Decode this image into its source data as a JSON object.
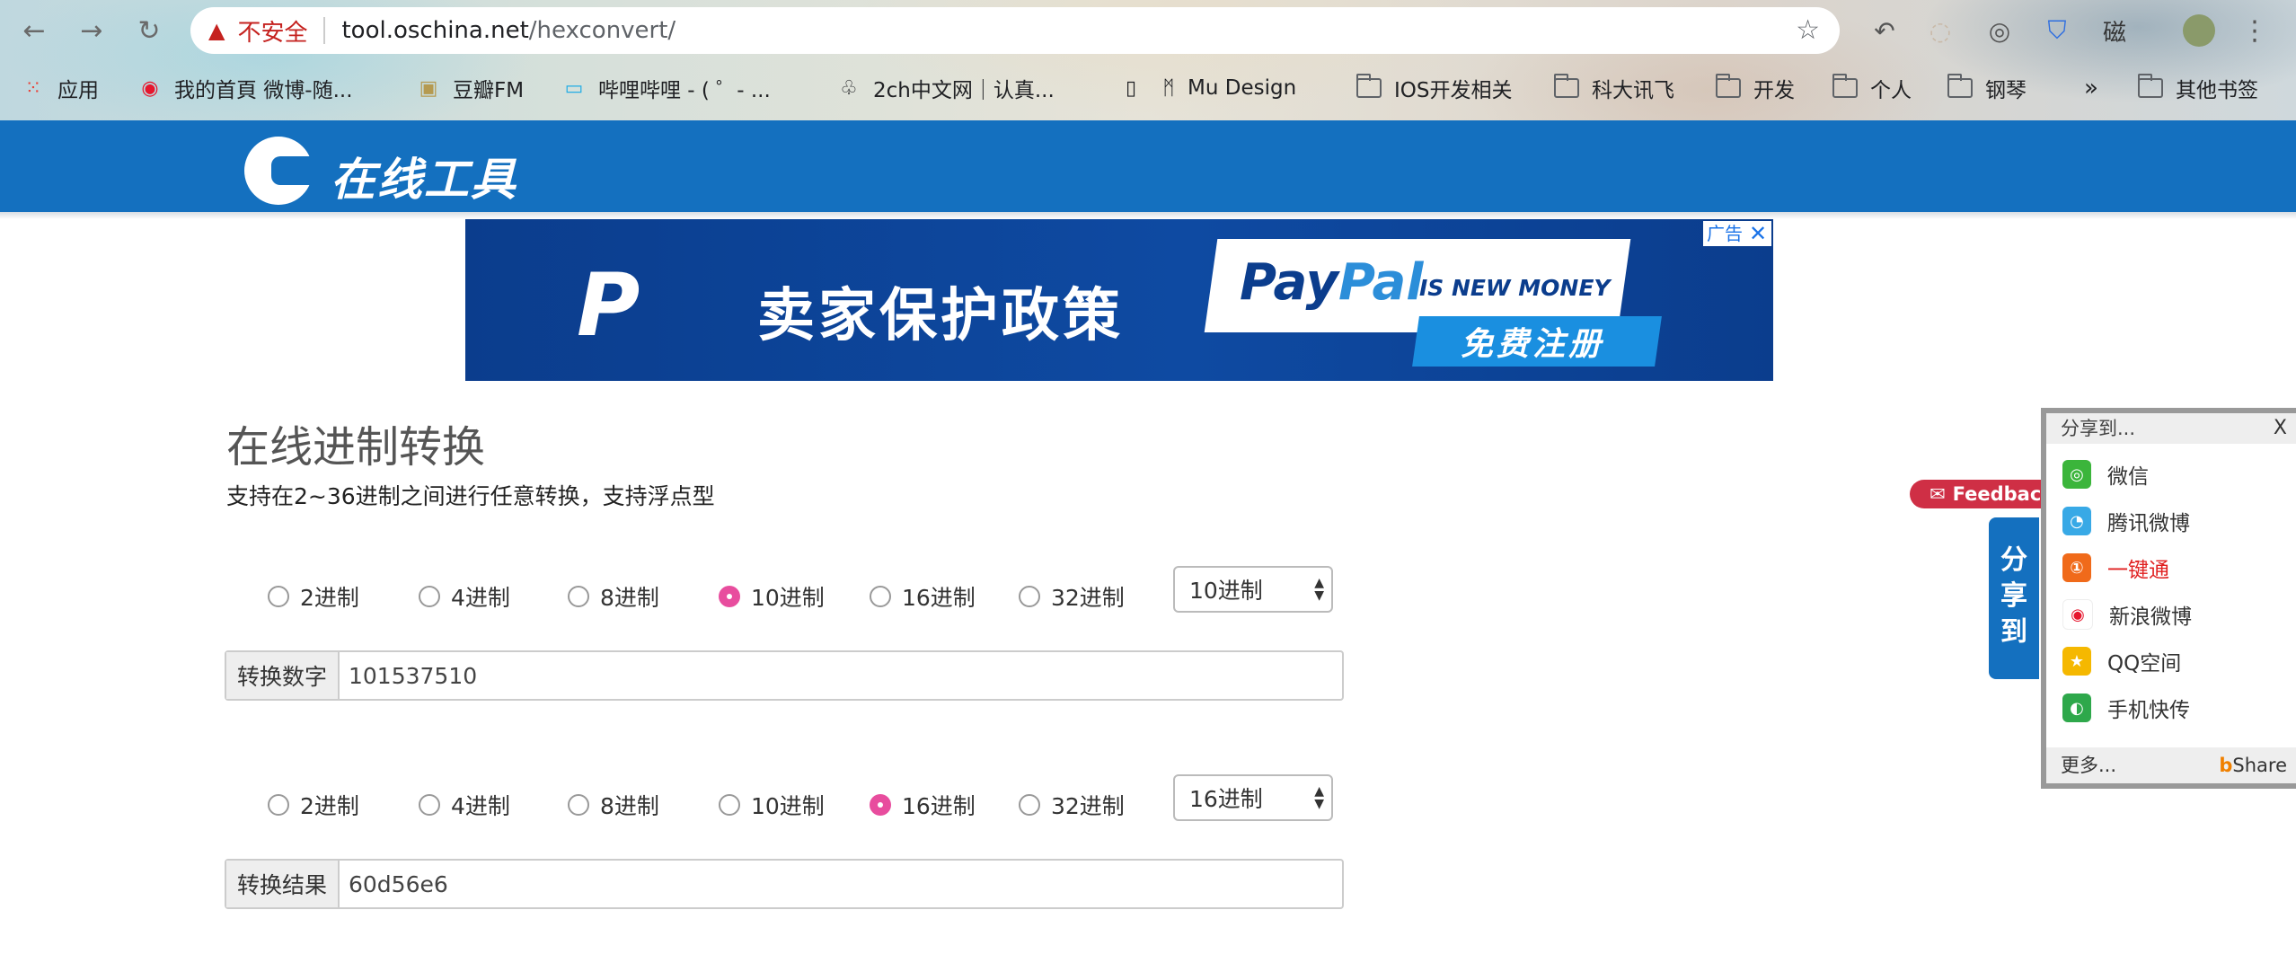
{
  "browser": {
    "address": {
      "security_label": "不安全",
      "host": "tool.oschina.net",
      "path": "/hexconvert/"
    },
    "extension_text": "磁",
    "bookmarks": [
      {
        "label": "应用",
        "icon": "apps-grid-icon"
      },
      {
        "label": "我的首頁 微博-随...",
        "icon": "weibo-icon"
      },
      {
        "label": "豆瓣FM",
        "icon": "douban-fm-icon"
      },
      {
        "label": "哔哩哔哩 - ( ゜- ...",
        "icon": "bilibili-icon"
      },
      {
        "label": "2ch中文网｜认真...",
        "icon": "2ch-icon"
      },
      {
        "label": "Mu Design",
        "icon": "page-icon"
      },
      {
        "label": "IOS开发相关",
        "icon": "folder-icon"
      },
      {
        "label": "科大讯飞",
        "icon": "folder-icon"
      },
      {
        "label": "开发",
        "icon": "folder-icon"
      },
      {
        "label": "个人",
        "icon": "folder-icon"
      },
      {
        "label": "钢琴",
        "icon": "folder-icon"
      }
    ],
    "overflow_label": "»",
    "other_bookmarks": "其他书签"
  },
  "site": {
    "logo_text": "在线工具"
  },
  "ad": {
    "headline": "卖家保护政策",
    "brand_pay": "Pay",
    "brand_pal": "Pal",
    "tagline": "IS NEW MONEY",
    "cta": "免费注册",
    "label": "广告",
    "close": "✕"
  },
  "main": {
    "title": "在线进制转换",
    "subtitle": "支持在2~36进制之间进行任意转换，支持浮点型",
    "source": {
      "options": [
        "2进制",
        "4进制",
        "8进制",
        "10进制",
        "16进制",
        "32进制"
      ],
      "selected_index": 3,
      "select_value": "10进制",
      "input_label": "转换数字",
      "input_value": "101537510"
    },
    "target": {
      "options": [
        "2进制",
        "4进制",
        "8进制",
        "10进制",
        "16进制",
        "32进制"
      ],
      "selected_index": 4,
      "select_value": "16进制",
      "output_label": "转换结果",
      "output_value": "60d56e6"
    }
  },
  "feedback": {
    "icon": "✉",
    "label": "Feedback"
  },
  "share": {
    "tab_label": [
      "分",
      "享",
      "到"
    ],
    "header": "分享到...",
    "close": "X",
    "items": [
      {
        "label": "微信",
        "icon": "wechat-icon",
        "color": "#3bb53b"
      },
      {
        "label": "腾讯微博",
        "icon": "tencent-weibo-icon",
        "color": "#38a9e6"
      },
      {
        "label": "一键通",
        "icon": "one-click-icon",
        "color": "#f06a1a",
        "highlight": "#e02020"
      },
      {
        "label": "新浪微博",
        "icon": "sina-weibo-icon",
        "color": "#e6162d"
      },
      {
        "label": "QQ空间",
        "icon": "qzone-icon",
        "color": "#f5b800"
      },
      {
        "label": "手机快传",
        "icon": "phone-transfer-icon",
        "color": "#2ea84b"
      }
    ],
    "more": "更多...",
    "brand_b": "b",
    "brand_rest": "Share"
  }
}
